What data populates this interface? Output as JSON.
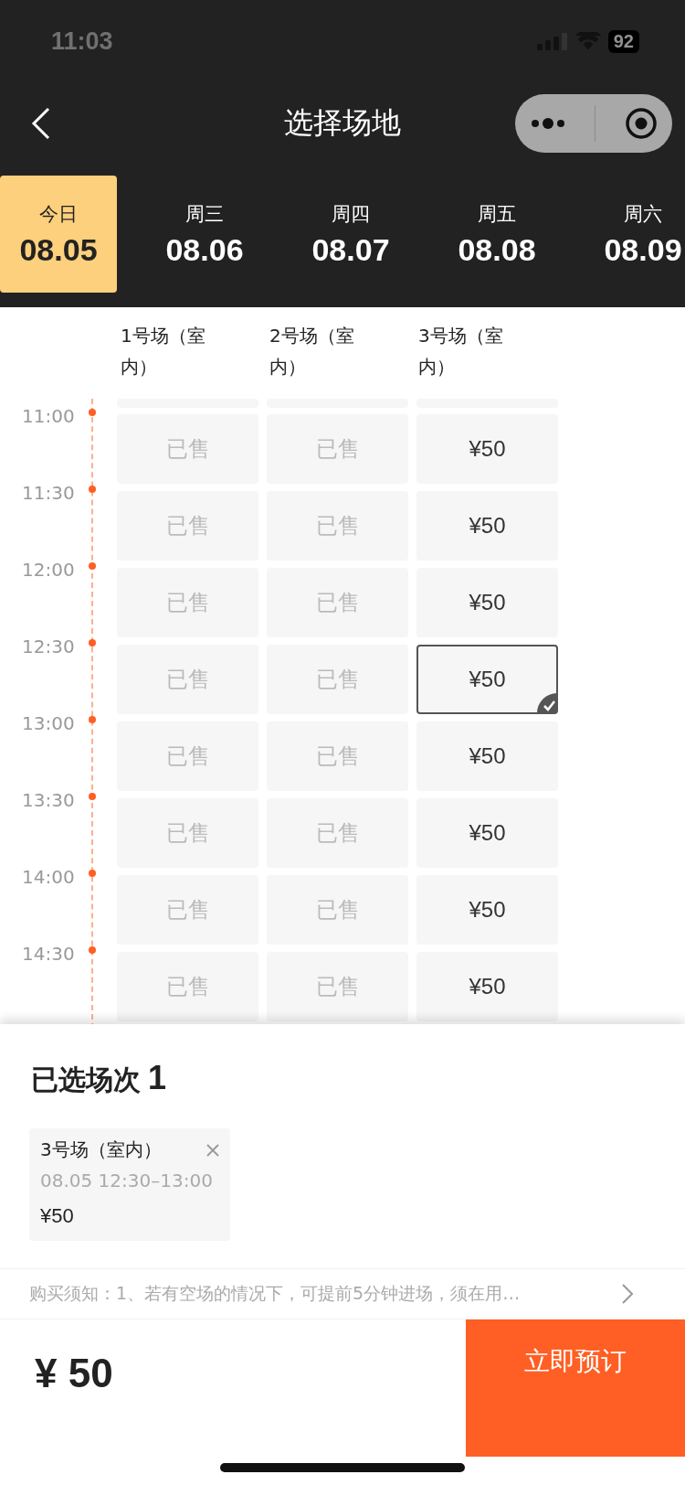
{
  "status_bar": {
    "time": "11:03",
    "battery": "92"
  },
  "nav": {
    "title": "选择场地"
  },
  "dates": [
    {
      "weekday": "今日",
      "date": "08.05",
      "selected": true
    },
    {
      "weekday": "周三",
      "date": "08.06",
      "selected": false
    },
    {
      "weekday": "周四",
      "date": "08.07",
      "selected": false
    },
    {
      "weekday": "周五",
      "date": "08.08",
      "selected": false
    },
    {
      "weekday": "周六",
      "date": "08.09",
      "selected": false
    }
  ],
  "courts": [
    "1号场（室内）",
    "2号场（室内）",
    "3号场（室内）"
  ],
  "slots": [
    {
      "time": "11:00",
      "cells": [
        {
          "kind": "sold",
          "text": "已售",
          "selected": false
        },
        {
          "kind": "sold",
          "text": "已售",
          "selected": false
        },
        {
          "kind": "available",
          "text": "¥50",
          "selected": false
        }
      ]
    },
    {
      "time": "11:30",
      "cells": [
        {
          "kind": "sold",
          "text": "已售",
          "selected": false
        },
        {
          "kind": "sold",
          "text": "已售",
          "selected": false
        },
        {
          "kind": "available",
          "text": "¥50",
          "selected": false
        }
      ]
    },
    {
      "time": "12:00",
      "cells": [
        {
          "kind": "sold",
          "text": "已售",
          "selected": false
        },
        {
          "kind": "sold",
          "text": "已售",
          "selected": false
        },
        {
          "kind": "available",
          "text": "¥50",
          "selected": false
        }
      ]
    },
    {
      "time": "12:30",
      "cells": [
        {
          "kind": "sold",
          "text": "已售",
          "selected": false
        },
        {
          "kind": "sold",
          "text": "已售",
          "selected": false
        },
        {
          "kind": "available",
          "text": "¥50",
          "selected": true
        }
      ]
    },
    {
      "time": "13:00",
      "cells": [
        {
          "kind": "sold",
          "text": "已售",
          "selected": false
        },
        {
          "kind": "sold",
          "text": "已售",
          "selected": false
        },
        {
          "kind": "available",
          "text": "¥50",
          "selected": false
        }
      ]
    },
    {
      "time": "13:30",
      "cells": [
        {
          "kind": "sold",
          "text": "已售",
          "selected": false
        },
        {
          "kind": "sold",
          "text": "已售",
          "selected": false
        },
        {
          "kind": "available",
          "text": "¥50",
          "selected": false
        }
      ]
    },
    {
      "time": "14:00",
      "cells": [
        {
          "kind": "sold",
          "text": "已售",
          "selected": false
        },
        {
          "kind": "sold",
          "text": "已售",
          "selected": false
        },
        {
          "kind": "available",
          "text": "¥50",
          "selected": false
        }
      ]
    },
    {
      "time": "14:30",
      "cells": [
        {
          "kind": "sold",
          "text": "已售",
          "selected": false
        },
        {
          "kind": "sold",
          "text": "已售",
          "selected": false
        },
        {
          "kind": "available",
          "text": "¥50",
          "selected": false
        }
      ]
    }
  ],
  "selection": {
    "title": "已选场次",
    "count": "1",
    "items": [
      {
        "court": "3号场（室内）",
        "time": "08.05 12:30–13:00",
        "price": "¥50"
      }
    ]
  },
  "notice": "购买须知：1、若有空场的情况下，可提前5分钟进场，须在用…",
  "footer": {
    "total": "¥ 50",
    "button": "立即预订"
  }
}
